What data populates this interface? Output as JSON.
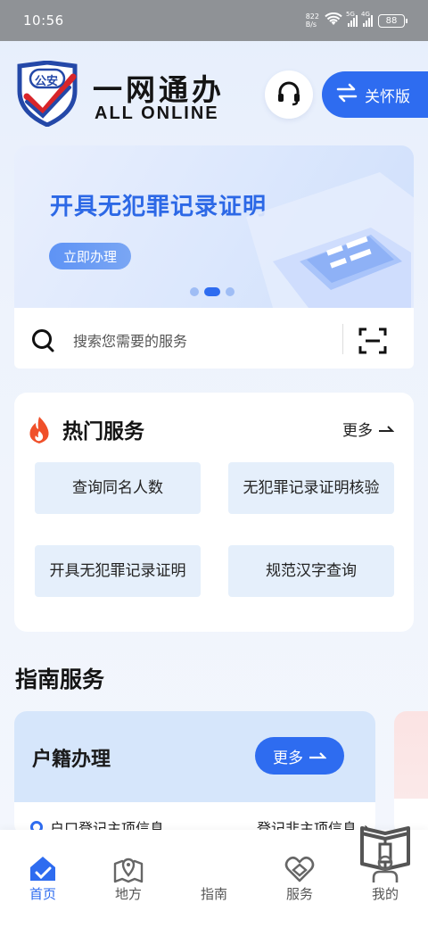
{
  "status_bar": {
    "time": "10:56",
    "net_speed_value": "822",
    "net_speed_unit": "B/s",
    "signal_1": "5G",
    "signal_2": "4G",
    "battery": "88"
  },
  "header": {
    "logo_text": "公安",
    "title": "一网通办",
    "subtitle": "ALL ONLINE",
    "care_mode_label": "关怀版"
  },
  "banner": {
    "title": "开具无犯罪记录证明",
    "button_label": "立即办理",
    "active_slide": 2,
    "slide_count": 3
  },
  "search": {
    "placeholder": "搜索您需要的服务"
  },
  "hot_services": {
    "title": "热门服务",
    "more_label": "更多",
    "items": [
      {
        "label": "查询同名人数"
      },
      {
        "label": "无犯罪记录证明核验"
      },
      {
        "label": "开具无犯罪记录证明"
      },
      {
        "label": "规范汉字查询"
      }
    ]
  },
  "guide_services": {
    "title": "指南服务",
    "card": {
      "title": "户籍办理",
      "more_label": "更多",
      "item_left": "户口登记主项信息",
      "item_right": "登记非主项信息"
    }
  },
  "tabbar": {
    "items": [
      {
        "label": "首页",
        "icon": "home-icon"
      },
      {
        "label": "地方",
        "icon": "map-icon"
      },
      {
        "label": "指南",
        "icon": "guide-book-icon"
      },
      {
        "label": "服务",
        "icon": "service-icon"
      },
      {
        "label": "我的",
        "icon": "user-icon"
      }
    ],
    "active": "首页"
  },
  "colors": {
    "accent": "#2e6cf0",
    "banner_title": "#2c68e6",
    "service_chip_bg": "#e5effb",
    "flame": "#f0502a"
  }
}
